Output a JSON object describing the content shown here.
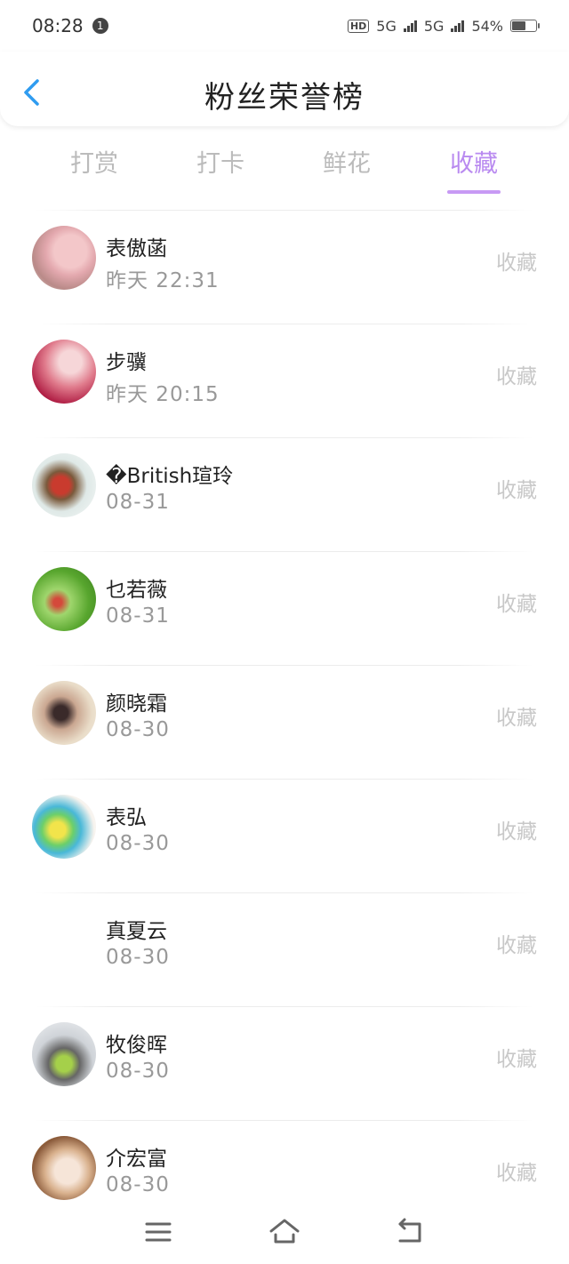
{
  "status": {
    "time": "08:28",
    "notif": "1",
    "battery": "54%",
    "network": "5G",
    "hd": "HD"
  },
  "header": {
    "title": "粉丝荣誉榜"
  },
  "tabs": [
    {
      "label": "打赏"
    },
    {
      "label": "打卡"
    },
    {
      "label": "鲜花"
    },
    {
      "label": "收藏"
    }
  ],
  "fans": [
    {
      "name": "表傲菡",
      "time": "昨天 22:31",
      "action": "收藏"
    },
    {
      "name": "步骥",
      "time": "昨天 20:15",
      "action": "收藏"
    },
    {
      "name": "�British瑄玲",
      "time": "08-31",
      "action": "收藏"
    },
    {
      "name": "乜若薇",
      "time": "08-31",
      "action": "收藏"
    },
    {
      "name": "颜晓霜",
      "time": "08-30",
      "action": "收藏"
    },
    {
      "name": "表弘",
      "time": "08-30",
      "action": "收藏"
    },
    {
      "name": "真夏云",
      "time": "08-30",
      "action": "收藏"
    },
    {
      "name": "牧俊晖",
      "time": "08-30",
      "action": "收藏"
    },
    {
      "name": "介宏富",
      "time": "08-30",
      "action": "收藏"
    }
  ],
  "colors": {
    "accent": "#b98af0",
    "back_arrow": "#2f9cf0"
  }
}
